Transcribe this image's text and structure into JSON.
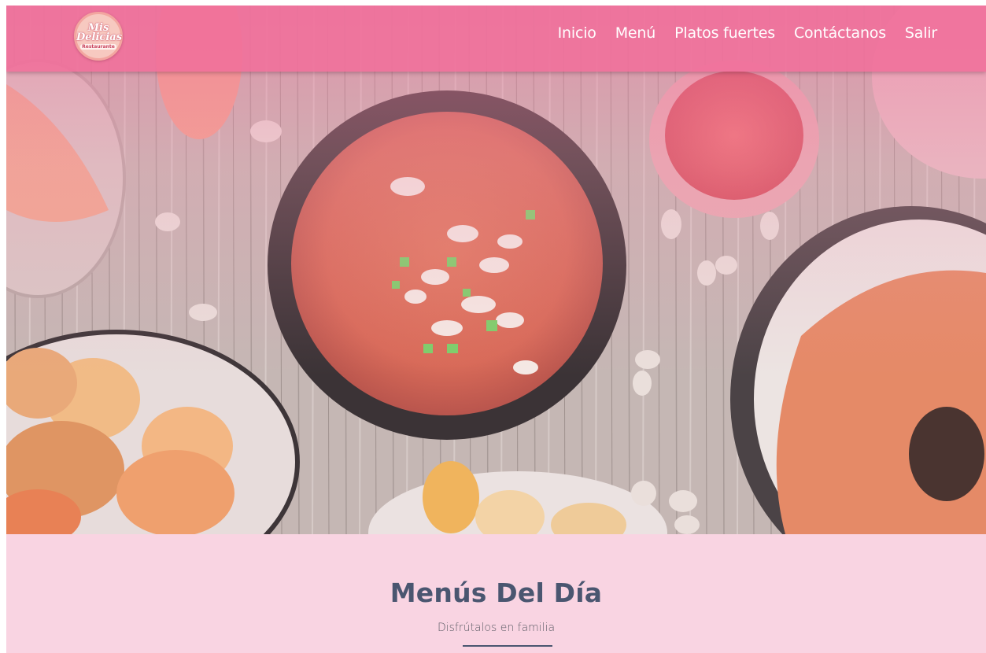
{
  "brand": {
    "logo_main": "Mis Delicias",
    "logo_sub": "Restaurante"
  },
  "nav": {
    "items": [
      {
        "label": "Inicio"
      },
      {
        "label": "Menú"
      },
      {
        "label": "Platos fuertes"
      },
      {
        "label": "Contáctanos"
      },
      {
        "label": "Salir"
      }
    ]
  },
  "hero": {
    "image": "food-table-photo"
  },
  "section": {
    "title": "Menús Del Día",
    "subtitle": "Disfrútalos en familia"
  },
  "colors": {
    "navbar": "#f0709b",
    "section_background": "#f9d4e2",
    "title": "#4a5670",
    "nav_text": "#ffffff"
  }
}
